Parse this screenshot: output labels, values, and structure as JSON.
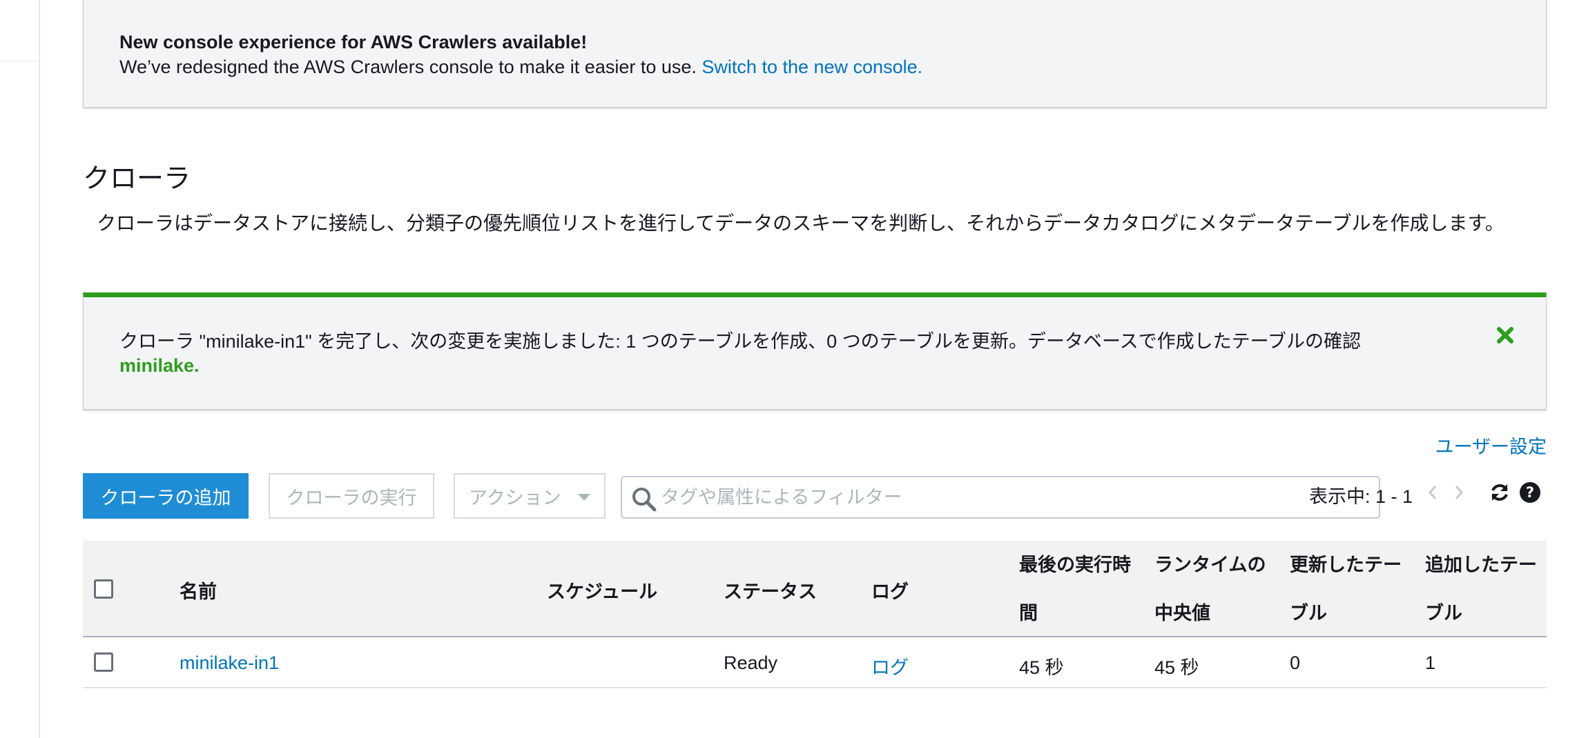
{
  "banner": {
    "title": "New console experience for AWS Crawlers available!",
    "description": "We’ve redesigned the AWS Crawlers console to make it easier to use.",
    "link": "Switch to the new console."
  },
  "page": {
    "title": "クローラ",
    "description": "クローラはデータストアに接続し、分類子の優先順位リストを進行してデータのスキーマを判断し、それからデータカタログにメタデータテーブルを作成します。"
  },
  "flash": {
    "message": "クローラ \"minilake-in1\" を完了し、次の変更を実施しました: 1 つのテーブルを作成、0 つのテーブルを更新。データベースで作成したテーブルの確認",
    "database_link": "minilake."
  },
  "toolbar": {
    "user_settings": "ユーザー設定",
    "add_crawler": "クローラの追加",
    "run_crawler": "クローラの実行",
    "action": "アクション",
    "filter_placeholder": "タグや属性によるフィルター",
    "pager_label": "表示中: 1 - 1"
  },
  "table": {
    "columns": {
      "name": "名前",
      "schedule": "スケジュール",
      "status": "ステータス",
      "log": "ログ",
      "last_runtime_1": "最後の実行時",
      "last_runtime_2": "間",
      "median_runtime_1": "ランタイムの",
      "median_runtime_2": "中央値",
      "tables_updated_1": "更新したテー",
      "tables_updated_2": "ブル",
      "tables_added_1": "追加したテー",
      "tables_added_2": "ブル"
    },
    "rows": [
      {
        "name": "minilake-in1",
        "schedule": "",
        "status": "Ready",
        "log": "ログ",
        "last_runtime": "45 秒",
        "median_runtime": "45 秒",
        "tables_updated": "0",
        "tables_added": "1"
      }
    ]
  },
  "colors": {
    "accent": "#0073bb",
    "primary_button": "#1f8dd6",
    "success": "#2d9e1e",
    "info_border": "#2b8fd6"
  },
  "icons": [
    "search-icon",
    "close-icon",
    "chevron-left-icon",
    "chevron-right-icon",
    "refresh-icon",
    "help-icon",
    "caret-down-icon"
  ]
}
